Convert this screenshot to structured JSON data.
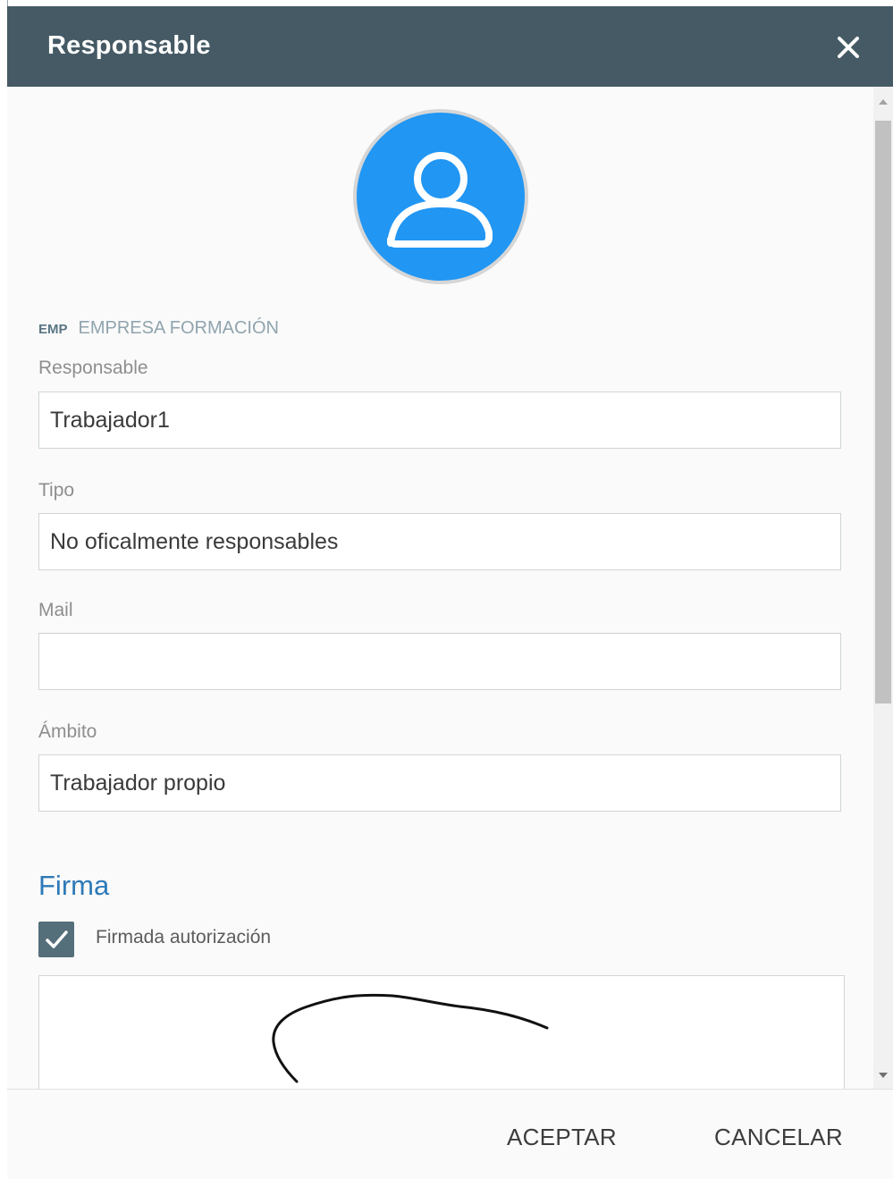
{
  "dialog": {
    "title": "Responsable",
    "close_icon": "close-icon"
  },
  "avatar": {
    "icon": "user-icon",
    "background_color": "#2196f3"
  },
  "company": {
    "code": "EMP",
    "name": "EMPRESA FORMACIÓN"
  },
  "fields": {
    "responsable": {
      "label": "Responsable",
      "value": "Trabajador1"
    },
    "tipo": {
      "label": "Tipo",
      "value": "No oficalmente responsables"
    },
    "mail": {
      "label": "Mail",
      "value": ""
    },
    "ambito": {
      "label": "Ámbito",
      "value": "Trabajador propio"
    }
  },
  "firma": {
    "section_title": "Firma",
    "checkbox_label": "Firmada autorización",
    "checked": true,
    "check_icon": "check-icon"
  },
  "footer": {
    "accept_label": "ACEPTAR",
    "cancel_label": "CANCELAR"
  },
  "colors": {
    "header": "#455a64",
    "section_title": "#2d7ab8",
    "checkbox": "#546e7a"
  }
}
